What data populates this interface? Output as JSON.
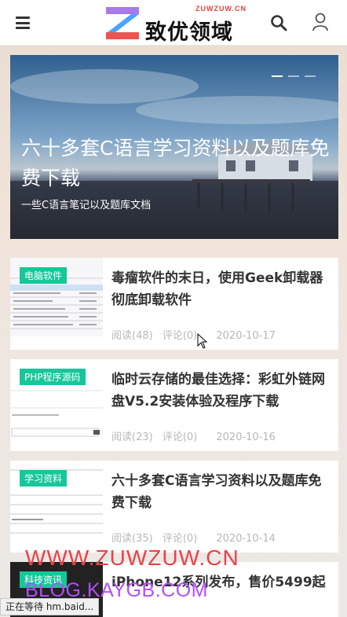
{
  "header": {
    "logo_sub": "ZUWZUW.CN",
    "logo_text": "致优领域",
    "icons": {
      "menu": "menu-icon",
      "search": "search-icon",
      "user": "user-icon",
      "logo": "logo-z-icon"
    }
  },
  "banner": {
    "title": "六十多套C语言学习资料以及题库免费下载",
    "subtitle": "一些C语言笔记以及题库文档",
    "slides": 3,
    "active_slide": 1
  },
  "articles": [
    {
      "tag": "电脑软件",
      "title": "毒瘤软件的末日，使用Geek卸载器彻底卸载软件",
      "reads": "阅读(48)",
      "comments": "评论(0)",
      "date": "2020-10-17"
    },
    {
      "tag": "PHP程序源码",
      "title": "临时云存储的最佳选择：彩虹外链网盘V5.2安装体验及程序下载",
      "reads": "阅读(23)",
      "comments": "评论(0)",
      "date": "2020-10-16"
    },
    {
      "tag": "学习资料",
      "title": "六十多套C语言学习资料以及题库免费下载",
      "reads": "阅读(35)",
      "comments": "评论(0)",
      "date": "2020-10-14"
    },
    {
      "tag": "科技资讯",
      "title": "iPhone12系列发布，售价5499起",
      "reads": "",
      "comments": "",
      "date": ""
    }
  ],
  "watermarks": {
    "line1": "WWW.ZUWZUW.CN",
    "line2": "BLOG.KAYGB.COM"
  },
  "status_bar": "正在等待 hm.baid...",
  "colors": {
    "tag_bg": "#16c79a",
    "watermark1": "#e8434b",
    "watermark2": "#b34dff"
  }
}
